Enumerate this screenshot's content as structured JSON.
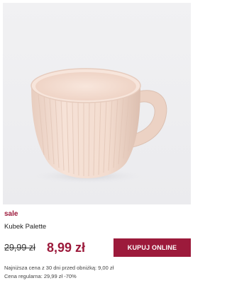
{
  "product": {
    "badge": "sale",
    "name": "Kubek Palette",
    "old_price": "29,99 zł",
    "new_price": "8,99 zł",
    "buy_button_label": "KUPUJ ONLINE",
    "lowest_price_info": "Najniższa cena z 30 dni przed obniżką: 9,00 zł",
    "regular_price_info": "Cena regularna: 29,99 zł -70%"
  },
  "colors": {
    "accent": "#9c1a3b",
    "image_background": "#eeeef0",
    "mug": "#f3ddd2"
  },
  "image": {
    "subject": "mug-image"
  }
}
